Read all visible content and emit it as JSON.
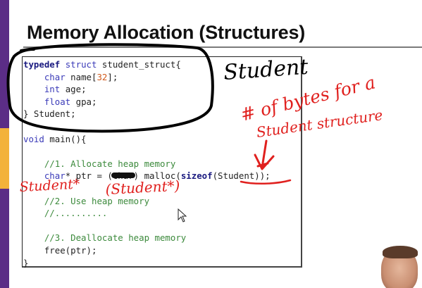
{
  "slide": {
    "title": "Memory Allocation (Structures)",
    "code_lines": [
      "typedef struct student_struct{",
      "    char name[32];",
      "    int age;",
      "    float gpa;",
      "} Student;",
      "",
      "void main(){",
      "",
      "    //1. Allocate heap memory",
      "    char* ptr = (char) malloc(sizeof(Student));",
      "",
      "    //2. Use heap memory",
      "    //..........",
      "",
      "    //3. Deallocate heap memory",
      "    free(ptr);",
      "}"
    ]
  },
  "annotations": {
    "student_label": "Student",
    "bytes_note_line1": "# of bytes for a",
    "bytes_note_line2": "Student structure",
    "student_ptr": "Student*",
    "student_ptr_cast": "(Student*)"
  },
  "colors": {
    "accent_purple": "#5b2d86",
    "accent_gold": "#f3b23a",
    "keyword": "#3a3ab8",
    "comment": "#3c8a3c",
    "number": "#d05a1c",
    "ink_red": "#e0201e",
    "ink_black": "#000000"
  },
  "icons": [
    "mouse-cursor-icon",
    "webcam-presenter"
  ]
}
